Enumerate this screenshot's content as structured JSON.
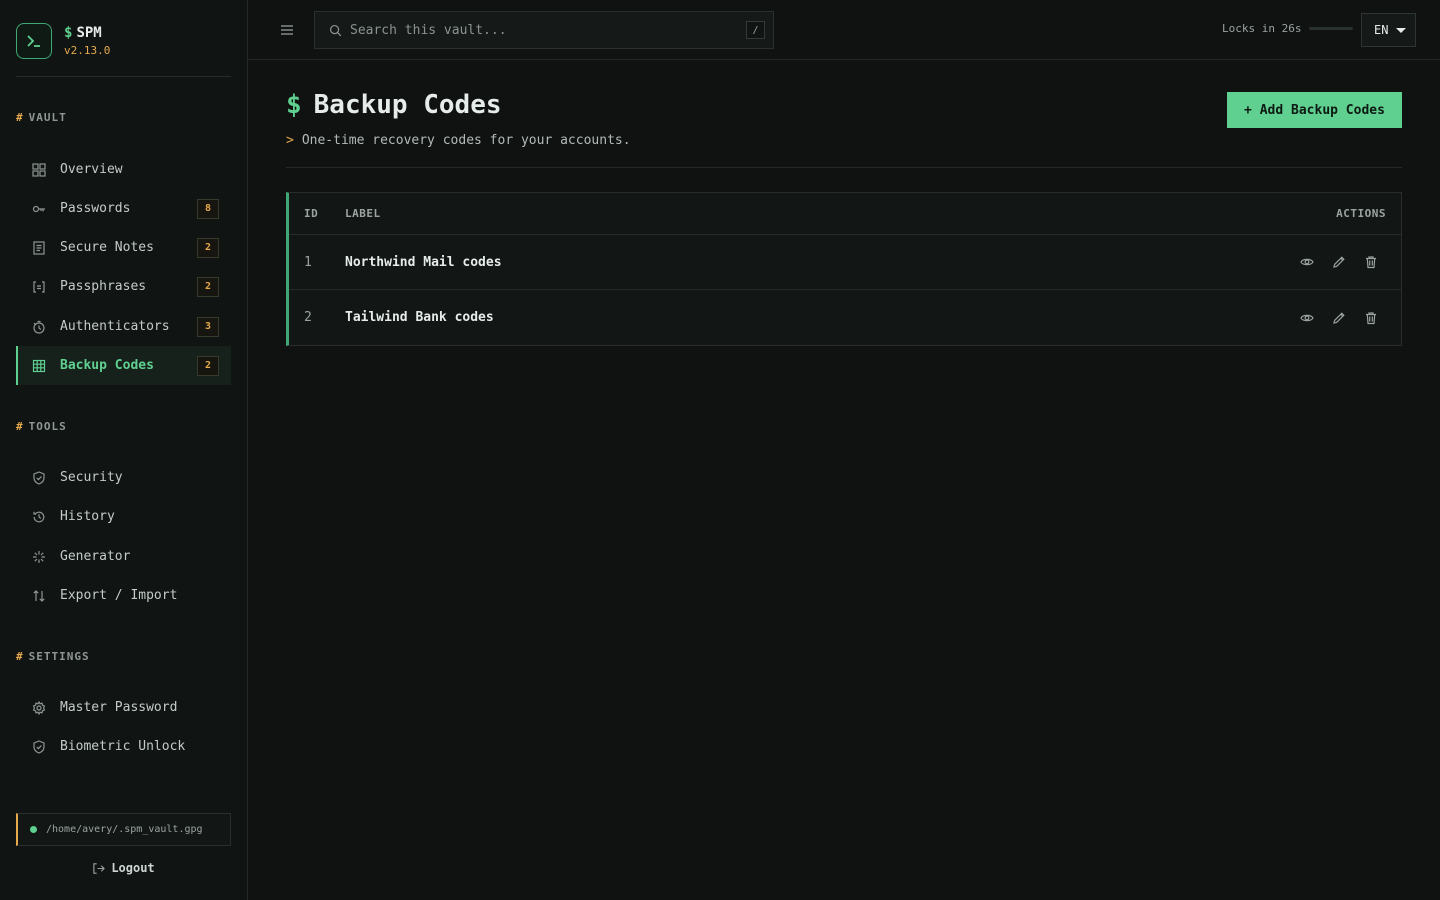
{
  "brand": {
    "dollar": "$",
    "name": "SPM",
    "version": "v2.13.0"
  },
  "sections": {
    "vault": {
      "hash": "#",
      "label": "VAULT"
    },
    "tools": {
      "hash": "#",
      "label": "TOOLS"
    },
    "settings": {
      "hash": "#",
      "label": "SETTINGS"
    }
  },
  "nav": {
    "vault": [
      {
        "label": "Overview",
        "icon": "grid-icon"
      },
      {
        "label": "Passwords",
        "icon": "key-icon",
        "badge": "8"
      },
      {
        "label": "Secure Notes",
        "icon": "note-icon",
        "badge": "2"
      },
      {
        "label": "Passphrases",
        "icon": "brackets-icon",
        "badge": "2"
      },
      {
        "label": "Authenticators",
        "icon": "clock-icon",
        "badge": "3"
      },
      {
        "label": "Backup Codes",
        "icon": "table-icon",
        "badge": "2",
        "active": true
      }
    ],
    "tools": [
      {
        "label": "Security",
        "icon": "shield-icon"
      },
      {
        "label": "History",
        "icon": "history-icon"
      },
      {
        "label": "Generator",
        "icon": "sparkle-icon"
      },
      {
        "label": "Export / Import",
        "icon": "arrows-updown-icon"
      }
    ],
    "settings": [
      {
        "label": "Master Password",
        "icon": "gear-icon"
      },
      {
        "label": "Biometric Unlock",
        "icon": "shield-icon"
      }
    ]
  },
  "vault_path": "/home/avery/.spm_vault.gpg",
  "logout_label": "Logout",
  "topbar": {
    "search_placeholder": "Search this vault...",
    "search_shortcut": "/",
    "lock_text": "Locks in 26s",
    "lock_progress": 0.0,
    "language": "EN"
  },
  "page": {
    "title_prefix": "$",
    "title": "Backup Codes",
    "subtitle_prefix": ">",
    "subtitle": "One-time recovery codes for your accounts.",
    "add_button": "+ Add Backup Codes"
  },
  "table": {
    "headers": {
      "id": "ID",
      "label": "LABEL",
      "actions": "ACTIONS"
    },
    "rows": [
      {
        "id": "1",
        "label": "Northwind Mail codes"
      },
      {
        "id": "2",
        "label": "Tailwind Bank codes"
      }
    ]
  },
  "colors": {
    "accent": "#5fd08f",
    "warning": "#e6a94d",
    "background": "#0f1211"
  }
}
